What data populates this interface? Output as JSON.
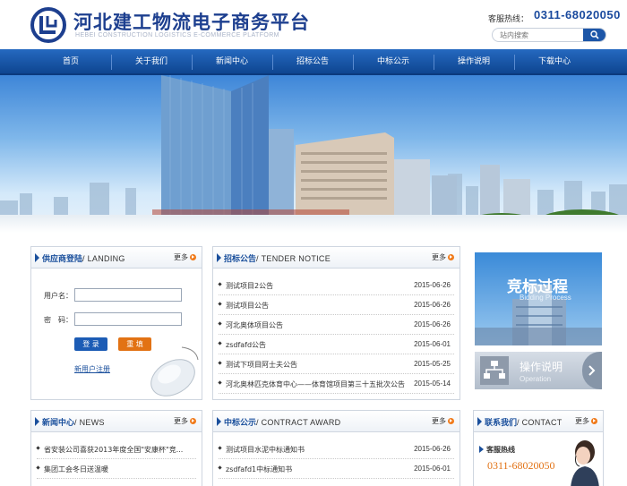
{
  "header": {
    "title": "河北建工物流电子商务平台",
    "subtitle": "HEBEI CONSTRUCTION LOGISTICS E-COMMERCE PLATFORM",
    "hotline_label": "客服热线：",
    "hotline_number": "0311-68020050",
    "search_placeholder": "站内搜索"
  },
  "nav": {
    "items": [
      "首页",
      "关于我们",
      "新闻中心",
      "招标公告",
      "中标公示",
      "操作说明",
      "下载中心"
    ]
  },
  "login_panel": {
    "title": "供应商登陆",
    "title_en": "/ LANDING",
    "more": "更多",
    "username_label": "用户名：",
    "password_label": "密　码：",
    "login_button": "登 录",
    "reset_button": "重 填",
    "register_link": "新用户注册"
  },
  "tender_panel": {
    "title": "招标公告",
    "title_en": "/ TENDER NOTICE",
    "more": "更多",
    "items": [
      {
        "text": "测试项目2公告",
        "date": "2015-06-26"
      },
      {
        "text": "测试项目公告",
        "date": "2015-06-26"
      },
      {
        "text": "河北奥体项目公告",
        "date": "2015-06-26"
      },
      {
        "text": "zsdfafd公告",
        "date": "2015-06-01"
      },
      {
        "text": "测试下项目阿士夫公告",
        "date": "2015-05-25"
      },
      {
        "text": "河北奥林匹克体育中心——体育馆项目第三十五批次公告",
        "date": "2015-05-14"
      }
    ]
  },
  "process_card": {
    "title": "竞标过程",
    "title_en": "Bidding Process"
  },
  "operation_card": {
    "title": "操作说明",
    "title_en": "Operation"
  },
  "news_panel": {
    "title": "新闻中心",
    "title_en": "/ NEWS",
    "more": "更多",
    "items": [
      {
        "text": "省安装公司喜获2013年度全国\"安康杯\"竞..."
      },
      {
        "text": "集团工会冬日送温暖"
      }
    ]
  },
  "award_panel": {
    "title": "中标公示",
    "title_en": "/ CONTRACT AWARD",
    "more": "更多",
    "items": [
      {
        "text": "测试项目水泥中标通知书",
        "date": "2015-06-26"
      },
      {
        "text": "zsdfafd1中标通知书",
        "date": "2015-06-01"
      }
    ]
  },
  "contact_panel": {
    "title": "联系我们",
    "title_en": "/ CONTACT",
    "more": "更多",
    "service_label": "客服热线",
    "service_number": "0311-68020050"
  },
  "colors": {
    "brand_blue": "#1a4f9c",
    "nav_blue": "#1a55a8",
    "accent_orange": "#e27214"
  }
}
